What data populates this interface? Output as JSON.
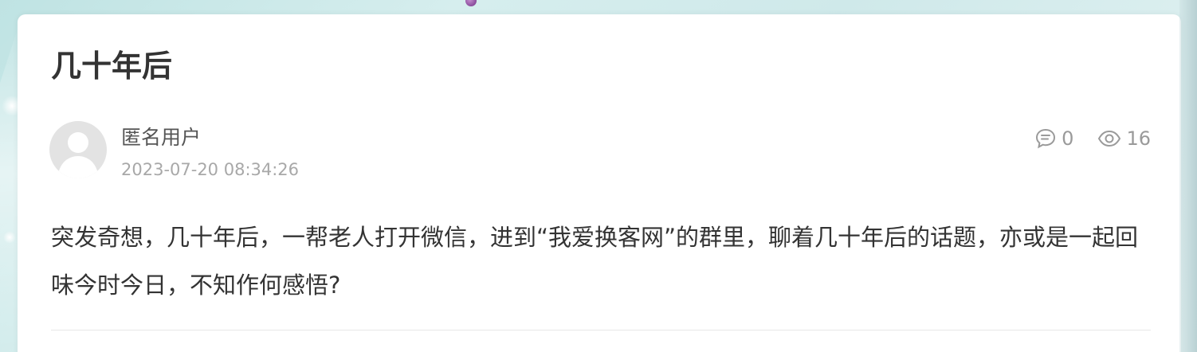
{
  "post": {
    "title": "几十年后",
    "author": "匿名用户",
    "date": "2023-07-20 08:34:26",
    "comment_count": "0",
    "view_count": "16",
    "body": "突发奇想，几十年后，一帮老人打开微信，进到“我爱换客网”的群里，聊着几十年后的话题，亦或是一起回味今时今日，不知作何感悟?"
  },
  "icons": {
    "comment": "comment-icon",
    "views": "eye-icon",
    "avatar": "user-avatar-placeholder"
  },
  "colors": {
    "title": "#333333",
    "meta": "#a8a8a8",
    "background": "#cfe9ea",
    "card": "#ffffff"
  }
}
